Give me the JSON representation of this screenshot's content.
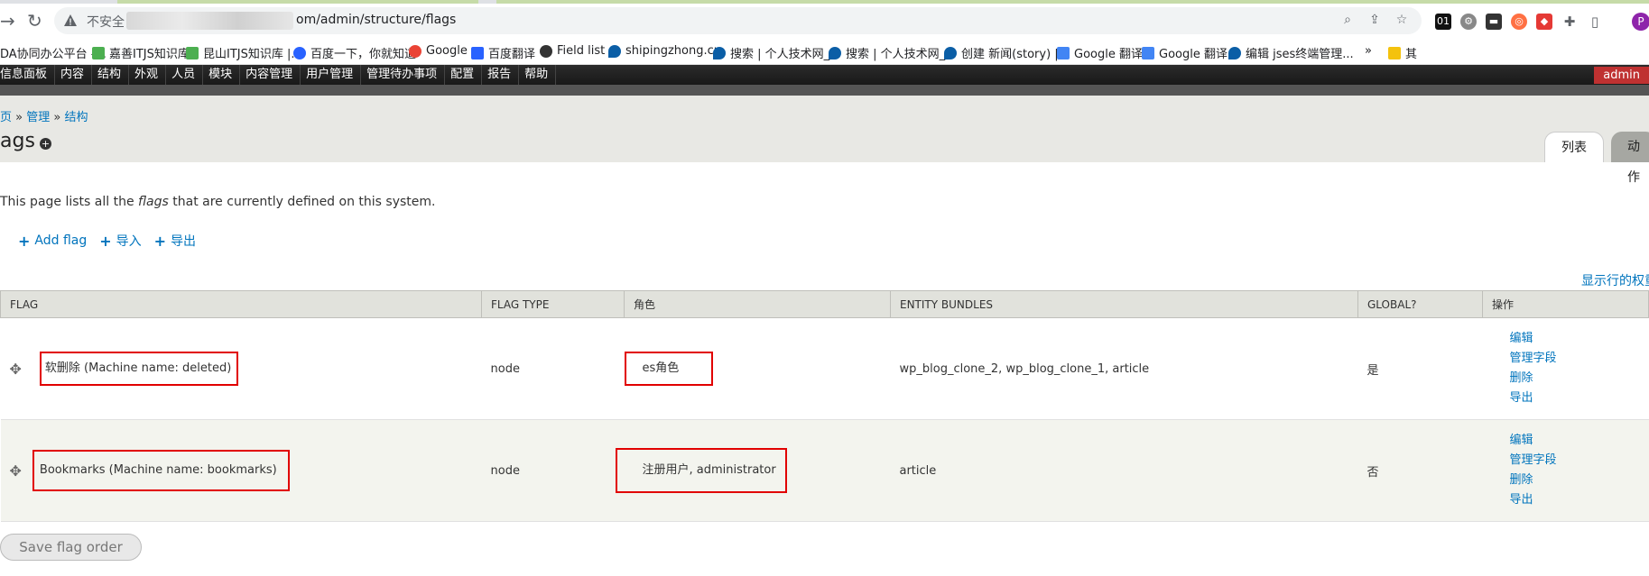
{
  "browser": {
    "insecure_label": "不安全",
    "url": "om/admin/structure/flags",
    "bookmarks": [
      {
        "label": "DA协同办公平台 -...",
        "color": "#ffffff"
      },
      {
        "label": "嘉善ITJS知识库",
        "color": "#4caf50"
      },
      {
        "label": "昆山ITJS知识库 |...",
        "color": "#4caf50"
      },
      {
        "label": "百度一下，你就知道",
        "color": "#2962ff"
      },
      {
        "label": "Google",
        "color": "#ea4335"
      },
      {
        "label": "百度翻译",
        "color": "#2962ff"
      },
      {
        "label": "Field list",
        "color": "#333333"
      },
      {
        "label": "shipingzhong.cn",
        "color": "#0b5ea6"
      },
      {
        "label": "搜索 | 个人技术网_...",
        "color": "#0b5ea6"
      },
      {
        "label": "搜索 | 个人技术网_...",
        "color": "#0b5ea6"
      },
      {
        "label": "创建 新闻(story) |...",
        "color": "#0b5ea6"
      },
      {
        "label": "Google 翻译",
        "color": "#4285f4"
      },
      {
        "label": "Google 翻译",
        "color": "#4285f4"
      },
      {
        "label": "编辑 jses终端管理...",
        "color": "#0b5ea6"
      },
      {
        "label": "其",
        "color": "#f4c20d"
      }
    ],
    "more_bookmarks": "»",
    "profile_initial": "P"
  },
  "toolbar": {
    "items": [
      "信息面板",
      "内容",
      "结构",
      "外观",
      "人员",
      "模块",
      "内容管理",
      "用户管理",
      "管理待办事项",
      "配置",
      "报告",
      "帮助"
    ],
    "user": "admin"
  },
  "header": {
    "crumb_home": "页",
    "crumb_sep": "»",
    "crumb_admin": "管理",
    "crumb_structure": "结构",
    "title": "ags",
    "tab_list": "列表",
    "tab_actions": "动作"
  },
  "content": {
    "intro_pre": "This page lists all the ",
    "intro_em": "flags",
    "intro_post": " that are currently defined on this system.",
    "actions": [
      "Add flag",
      "导入",
      "导出"
    ],
    "show_weights": "显示行的权重",
    "columns": [
      "FLAG",
      "FLAG TYPE",
      "角色",
      "ENTITY BUNDLES",
      "GLOBAL?",
      "操作"
    ],
    "rows": [
      {
        "flag": "软删除 (Machine name: deleted)",
        "type": "node",
        "roles": "es角色",
        "bundles": "wp_blog_clone_2, wp_blog_clone_1, article",
        "global": "是",
        "ops": [
          "编辑",
          "管理字段",
          "删除",
          "导出"
        ]
      },
      {
        "flag": "Bookmarks (Machine name: bookmarks)",
        "type": "node",
        "roles": "注册用户, administrator",
        "bundles": "article",
        "global": "否",
        "ops": [
          "编辑",
          "管理字段",
          "删除",
          "导出"
        ]
      }
    ],
    "save_button": "Save flag order"
  }
}
